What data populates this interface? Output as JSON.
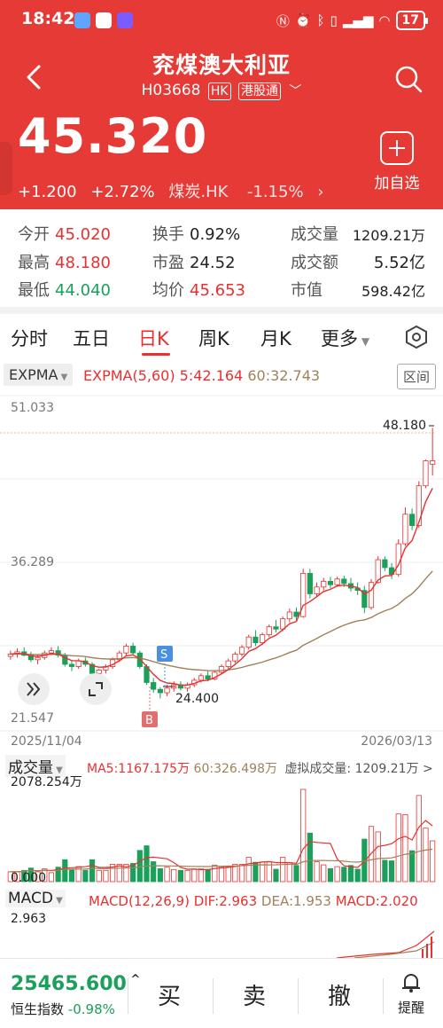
{
  "status": {
    "time": "18:42",
    "battery": "17"
  },
  "header": {
    "name": "兖煤澳大利亚",
    "code": "H03668",
    "market_tag": "HK",
    "connect_tag": "港股通",
    "price": "45.320",
    "change": "+1.200",
    "change_pct": "+2.72%",
    "sector": "煤炭.HK",
    "sector_pct": "-1.15%",
    "add_watch": "加自选"
  },
  "quote": {
    "open_label": "今开",
    "open": "45.020",
    "high_label": "最高",
    "high": "48.180",
    "low_label": "最低",
    "low": "44.040",
    "turnover_rate_label": "换手",
    "turnover_rate": "0.92%",
    "pe_label": "市盈",
    "pe": "24.52",
    "avg_label": "均价",
    "avg": "45.653",
    "volume_label": "成交量",
    "volume": "1209.21万",
    "amount_label": "成交额",
    "amount": "5.52亿",
    "mktcap_label": "市值",
    "mktcap": "598.42亿"
  },
  "tabs": [
    "分时",
    "五日",
    "日K",
    "周K",
    "月K",
    "更多"
  ],
  "indicator": {
    "main_select": "EXPMA",
    "main_name": "EXPMA(5,60)",
    "ema5": "5:42.164",
    "ema60": "60:32.743",
    "range_button": "区间",
    "y_top": "51.033",
    "y_mid": "36.289",
    "y_bottom": "21.547",
    "high_label": "48.180",
    "low_label": "24.400",
    "date_start": "2025/11/04",
    "date_end": "2026/03/13",
    "marker_s": "S",
    "marker_b": "B"
  },
  "volume": {
    "select": "成交量",
    "ma5": "MA5:1167.175万",
    "ma60": "60:326.498万",
    "virtual": "虚拟成交量: 1209.21万 >",
    "y_top": "2078.254万",
    "y_bottom": "0.000"
  },
  "macd": {
    "select": "MACD",
    "name": "MACD(12,26,9)",
    "dif": "DIF:2.963",
    "dea": "DEA:1.953",
    "macd": "MACD:2.020",
    "y_top": "2.963"
  },
  "bottom": {
    "index_value": "25465.600",
    "index_name": "恒生指数",
    "index_pct": "-0.98%",
    "buy": "买",
    "sell": "卖",
    "cancel": "撤",
    "alert": "提醒"
  },
  "colors": {
    "up": "#e8302f",
    "down": "#1aa05a",
    "header": "#e53a35",
    "ema60": "#a0815a"
  },
  "chart_data": {
    "type": "candlestick",
    "ylim": [
      21.547,
      51.033
    ],
    "ohlc": [
      [
        28.1,
        28.6,
        27.8,
        28.3
      ],
      [
        28.3,
        28.8,
        28.0,
        28.5
      ],
      [
        28.5,
        28.9,
        28.1,
        28.2
      ],
      [
        28.2,
        28.5,
        27.6,
        27.8
      ],
      [
        27.8,
        28.2,
        27.4,
        28.0
      ],
      [
        28.0,
        28.6,
        27.8,
        28.4
      ],
      [
        28.4,
        28.9,
        28.2,
        28.6
      ],
      [
        28.6,
        29.0,
        28.0,
        28.2
      ],
      [
        28.2,
        28.4,
        27.2,
        27.4
      ],
      [
        27.4,
        27.8,
        26.8,
        27.2
      ],
      [
        27.2,
        27.9,
        27.0,
        27.7
      ],
      [
        27.7,
        28.0,
        27.2,
        27.4
      ],
      [
        27.4,
        27.6,
        26.4,
        26.6
      ],
      [
        26.6,
        27.0,
        26.2,
        26.9
      ],
      [
        26.9,
        27.4,
        26.6,
        27.2
      ],
      [
        27.2,
        28.0,
        27.0,
        27.8
      ],
      [
        27.8,
        28.6,
        27.6,
        28.4
      ],
      [
        28.4,
        29.2,
        28.2,
        29.0
      ],
      [
        29.0,
        29.3,
        28.2,
        28.4
      ],
      [
        28.4,
        28.6,
        27.0,
        27.2
      ],
      [
        27.2,
        27.4,
        25.6,
        25.8
      ],
      [
        25.8,
        26.2,
        24.9,
        25.2
      ],
      [
        25.2,
        25.4,
        24.4,
        24.9
      ],
      [
        24.9,
        25.6,
        24.6,
        25.3
      ],
      [
        25.3,
        25.9,
        25.0,
        25.6
      ],
      [
        25.6,
        25.9,
        25.1,
        25.3
      ],
      [
        25.3,
        25.8,
        25.0,
        25.6
      ],
      [
        25.6,
        26.2,
        25.4,
        26.0
      ],
      [
        26.0,
        26.6,
        25.8,
        26.4
      ],
      [
        26.4,
        26.8,
        25.9,
        26.1
      ],
      [
        26.1,
        26.9,
        26.0,
        26.7
      ],
      [
        26.7,
        27.4,
        26.5,
        27.2
      ],
      [
        27.2,
        27.9,
        27.0,
        27.7
      ],
      [
        27.7,
        28.5,
        27.5,
        28.3
      ],
      [
        28.3,
        29.1,
        28.1,
        28.9
      ],
      [
        28.9,
        30.0,
        28.7,
        29.8
      ],
      [
        29.8,
        30.4,
        29.0,
        29.3
      ],
      [
        29.3,
        30.2,
        29.1,
        30.0
      ],
      [
        30.0,
        30.9,
        29.8,
        30.7
      ],
      [
        30.7,
        31.3,
        30.2,
        30.5
      ],
      [
        30.5,
        31.6,
        30.3,
        31.4
      ],
      [
        31.4,
        32.3,
        31.1,
        32.0
      ],
      [
        32.0,
        32.4,
        31.2,
        31.6
      ],
      [
        31.6,
        35.8,
        31.5,
        35.4
      ],
      [
        35.4,
        35.8,
        33.2,
        33.6
      ],
      [
        33.6,
        34.6,
        33.3,
        34.2
      ],
      [
        34.2,
        35.0,
        33.9,
        34.7
      ],
      [
        34.7,
        35.1,
        34.1,
        34.4
      ],
      [
        34.4,
        35.1,
        34.2,
        34.9
      ],
      [
        34.9,
        35.2,
        34.2,
        34.5
      ],
      [
        34.5,
        35.0,
        33.8,
        34.1
      ],
      [
        34.1,
        34.6,
        33.5,
        33.9
      ],
      [
        33.9,
        34.3,
        31.9,
        32.4
      ],
      [
        32.4,
        34.9,
        32.2,
        34.6
      ],
      [
        34.6,
        36.9,
        34.5,
        36.6
      ],
      [
        36.6,
        36.9,
        35.6,
        35.9
      ],
      [
        35.9,
        36.3,
        34.9,
        35.3
      ],
      [
        35.3,
        38.4,
        35.1,
        38.0
      ],
      [
        38.0,
        41.2,
        37.8,
        40.6
      ],
      [
        40.6,
        41.1,
        39.2,
        39.6
      ],
      [
        39.6,
        43.5,
        39.4,
        43.1
      ],
      [
        43.1,
        45.4,
        42.9,
        45.3
      ],
      [
        45.0,
        48.2,
        44.0,
        45.3
      ]
    ],
    "ema5_last": 42.164,
    "ema60_last": 32.743,
    "annotations": {
      "high": 48.18,
      "low": 24.4,
      "date_start": "2025/11/04",
      "date_end": "2026/03/13"
    },
    "volume_max_wan": 2078.254
  }
}
